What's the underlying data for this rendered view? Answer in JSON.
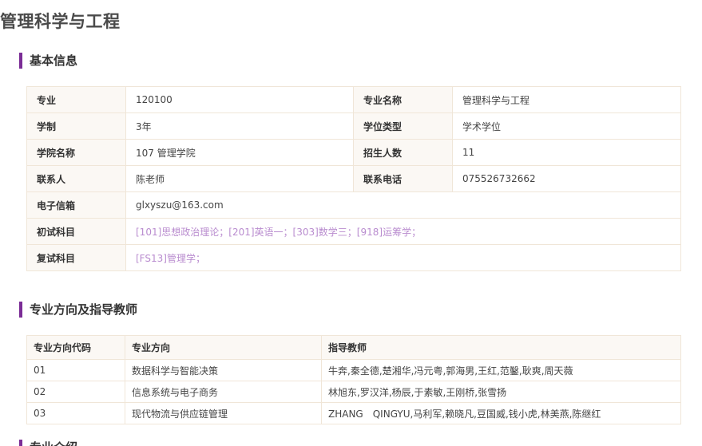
{
  "page": {
    "title": "管理科学与工程"
  },
  "basic": {
    "heading": "基本信息",
    "rows": {
      "major_label": "专业",
      "major_value": "120100",
      "major_name_label": "专业名称",
      "major_name_value": "管理科学与工程",
      "duration_label": "学制",
      "duration_value": "3年",
      "degree_type_label": "学位类型",
      "degree_type_value": "学术学位",
      "college_label": "学院名称",
      "college_value": "107 管理学院",
      "enroll_label": "招生人数",
      "enroll_value": "11",
      "contact_label": "联系人",
      "contact_value": "陈老师",
      "phone_label": "联系电话",
      "phone_value": "075526732662",
      "email_label": "电子信箱",
      "email_value": "glxyszu@163.com",
      "prelim_label": "初试科目",
      "prelim_value": "[101]思想政治理论；[201]英语一；[303]数学三；[918]运筹学；",
      "retest_label": "复试科目",
      "retest_value": "[FS13]管理学；"
    }
  },
  "directions": {
    "heading": "专业方向及指导教师",
    "columns": [
      "专业方向代码",
      "专业方向",
      "指导教师"
    ],
    "rows": [
      {
        "code": "01",
        "name": "数据科学与智能决策",
        "teachers": "牛奔,秦全德,楚湘华,冯元粤,郭海男,王红,范鑿,耿爽,周天薇"
      },
      {
        "code": "02",
        "name": "信息系统与电子商务",
        "teachers": "林旭东,罗汉洋,杨辰,于素敏,王刚桥,张雪扬"
      },
      {
        "code": "03",
        "name": "现代物流与供应链管理",
        "teachers": "ZHANG　QINGYU,马利军,赖晓凡,豆国威,钱小虎,林美燕,陈继红"
      }
    ]
  },
  "intro": {
    "heading": "专业介绍"
  },
  "colors": {
    "accent": "#7b2d96",
    "link": "#b98ccf",
    "border": "#f0e6d8",
    "label_bg": "#fbf8f4"
  }
}
